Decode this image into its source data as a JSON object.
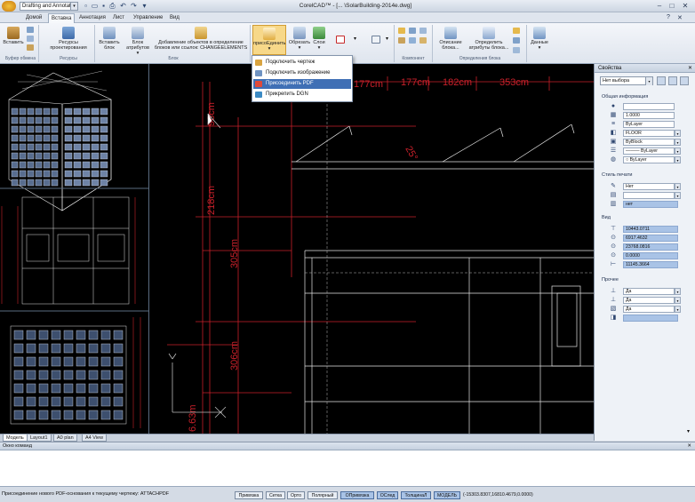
{
  "titlebar": {
    "workspace": "Drafting and Annotation",
    "title": "CorelCAD™ - [... \\SolarBuilding-2014e.dwg]"
  },
  "menu": {
    "tabs": [
      "Домой",
      "Вставка",
      "Аннотация",
      "Лист",
      "Управление",
      "Вид"
    ]
  },
  "ribbon": {
    "buttons": [
      {
        "label": "Вставить",
        "label2": ""
      },
      {
        "label": "Ресурсы",
        "label2": "проектирования"
      },
      {
        "label": "Вставить",
        "label2": "блок"
      },
      {
        "label": "Блок",
        "label2": "атрибутов ▾"
      },
      {
        "label": "Добавление объектов в определение",
        "label2": "блоков или ссылок: CHANGEELEMENTS"
      },
      {
        "label": "присоЕдинить",
        "label2": "▾"
      },
      {
        "label": "Обрезать",
        "label2": "▾"
      },
      {
        "label": "Слои",
        "label2": "▾"
      },
      {
        "label": "Описание",
        "label2": "блока..."
      },
      {
        "label": "Определить",
        "label2": "атрибуты блока..."
      },
      {
        "label": "Данные",
        "label2": "▾"
      }
    ],
    "groups": [
      "Буфер обмена",
      "Ресурсы",
      "Блок",
      "Компонент",
      "Определения блока"
    ]
  },
  "dropdown": {
    "items": [
      "Подключить чертеж",
      "Подключить изображение",
      "Присоединить PDF",
      "Прикрепить DGN"
    ],
    "highlighted_index": 2
  },
  "layout_tabs": [
    "Модель",
    "Layout1",
    "A0 plan",
    "A4 View"
  ],
  "drawing": {
    "dimensions_top": [
      "177cm",
      "182cm",
      "353cm"
    ],
    "dimensions_vertical": [
      "98cm",
      "218cm",
      "305cm",
      "306cm",
      "6.63m"
    ],
    "angle": "25°"
  },
  "properties": {
    "title": "Свойства",
    "selection": "Нет выбора",
    "sections": {
      "general": "Общая информация",
      "print_style": "Стиль печати",
      "view": "Вид",
      "misc": "Прочее"
    },
    "general_rows": [
      "",
      "1.0000",
      "ByLayer",
      "FLOOR",
      "ByBlock",
      "——— ByLayer",
      "○ ByLayer"
    ],
    "print_rows": [
      "Нет",
      "",
      "нет"
    ],
    "view_rows": [
      "10443.0711",
      "6917.4632",
      "23768.0816",
      "0.0000",
      "11145.3664"
    ],
    "misc_rows": [
      "Да",
      "Да",
      "Да",
      ""
    ]
  },
  "command_window": {
    "title": "Окно команд",
    "content": ""
  },
  "status": {
    "message": "Присоединение нового PDF-основания к текущему чертежу: ATTACHPDF",
    "buttons": [
      {
        "label": "Привязка",
        "on": false
      },
      {
        "label": "Сетка",
        "on": false
      },
      {
        "label": "Орто",
        "on": false
      },
      {
        "label": "Полярный",
        "on": false
      },
      {
        "label": "ОПривязка",
        "on": true
      },
      {
        "label": "ОСлед",
        "on": true
      },
      {
        "label": "ТолщинаЛ",
        "on": true
      },
      {
        "label": "МОДЕЛЬ",
        "on": true
      }
    ],
    "coordinates": "(-15303.8307,16810.4679,0.0000)"
  },
  "colors": {
    "accent": "#3f6fb5",
    "canvas": "#000000",
    "dimension_red": "#c8202a",
    "highlight_blue": "#a9c3e6"
  }
}
